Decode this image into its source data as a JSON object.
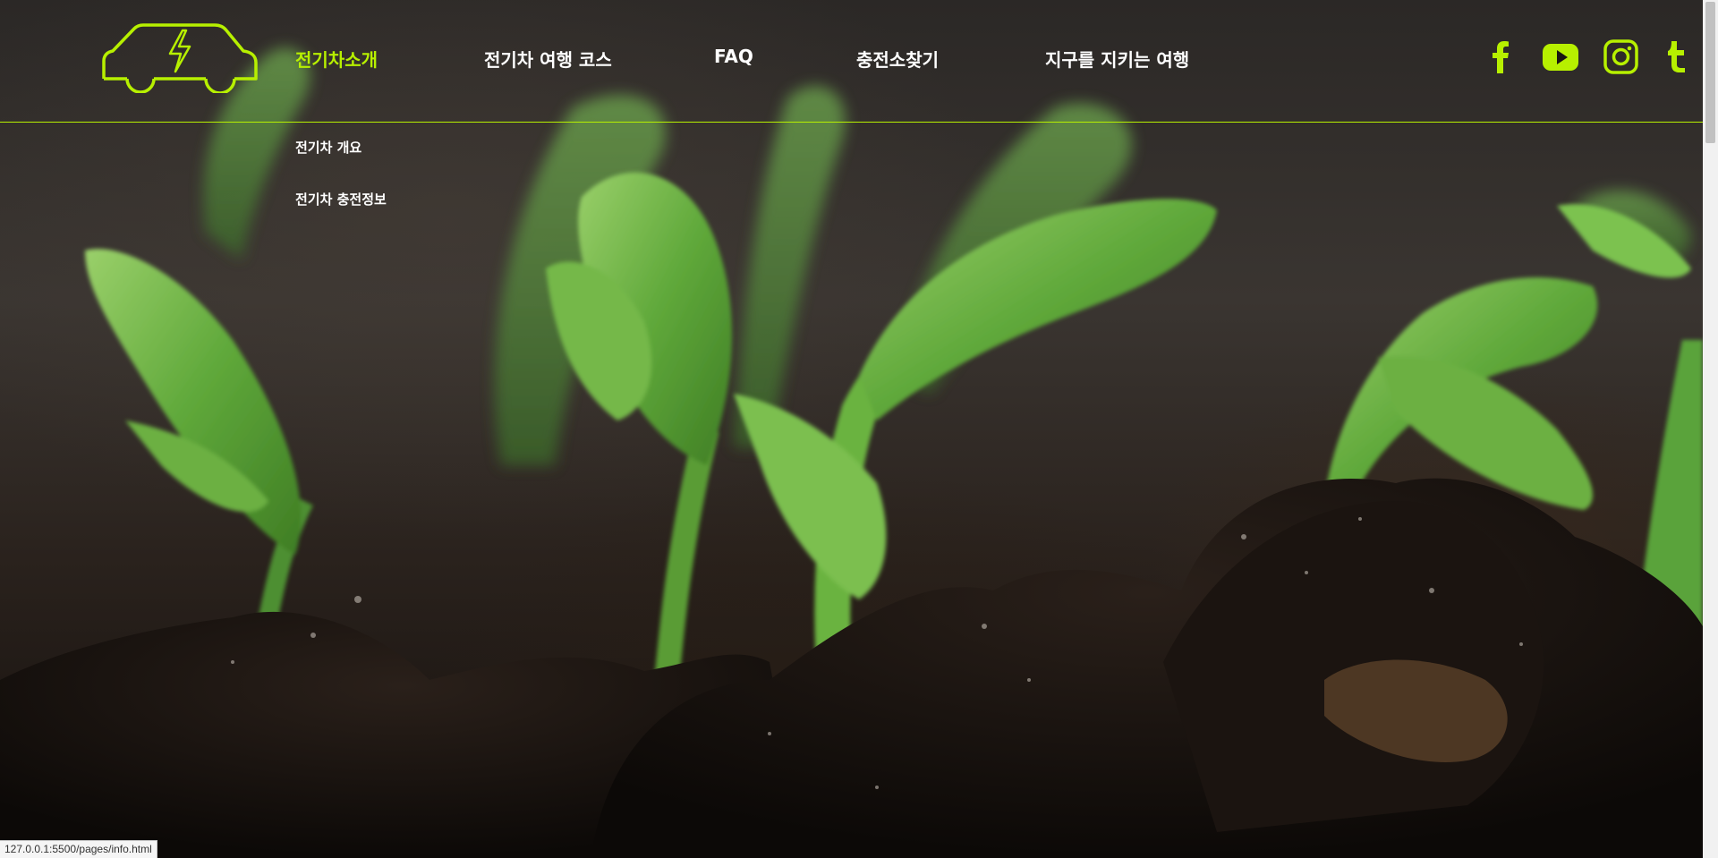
{
  "brand": {
    "accent_color": "#b7f000",
    "logo_icon": "electric-car-icon"
  },
  "nav": {
    "items": [
      {
        "label": "전기차소개",
        "active": true
      },
      {
        "label": "전기차 여행 코스",
        "active": false
      },
      {
        "label": "FAQ",
        "active": false
      },
      {
        "label": "충전소찾기",
        "active": false
      },
      {
        "label": "지구를 지키는 여행",
        "active": false
      }
    ],
    "submenu": [
      {
        "label": "전기차 개요"
      },
      {
        "label": "전기차 충전정보"
      }
    ]
  },
  "social": [
    {
      "icon": "facebook-icon"
    },
    {
      "icon": "youtube-icon"
    },
    {
      "icon": "instagram-icon"
    },
    {
      "icon": "tumblr-icon"
    }
  ],
  "hero": {
    "image": "seedlings-sprouting-from-soil"
  },
  "status_bar": {
    "url": "127.0.0.1:5500/pages/info.html"
  }
}
